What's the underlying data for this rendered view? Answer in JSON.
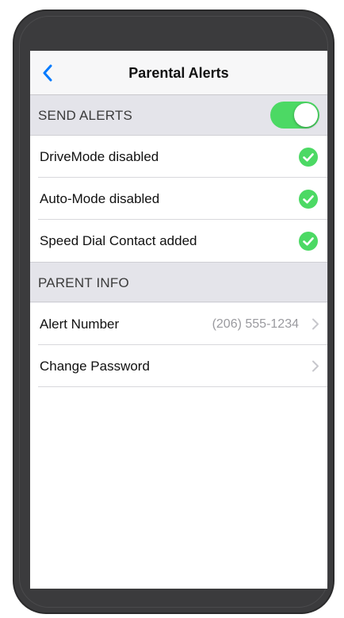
{
  "nav": {
    "title": "Parental Alerts",
    "back_icon": "chevron-left-icon"
  },
  "send_alerts": {
    "header": "SEND ALERTS",
    "toggle_on": true,
    "toggle_color": "#4cd964",
    "items": [
      {
        "label": "DriveMode disabled",
        "icon": "check-circle-icon"
      },
      {
        "label": "Auto-Mode disabled",
        "icon": "check-circle-icon"
      },
      {
        "label": "Speed Dial Contact added",
        "icon": "check-circle-icon"
      }
    ]
  },
  "parent_info": {
    "header": "PARENT INFO",
    "alert_number_label": "Alert Number",
    "alert_number_value": "(206) 555-1234",
    "change_password_label": "Change Password"
  },
  "colors": {
    "accent": "#007aff",
    "check": "#4cd964",
    "phone_body": "#3b3b3d"
  }
}
